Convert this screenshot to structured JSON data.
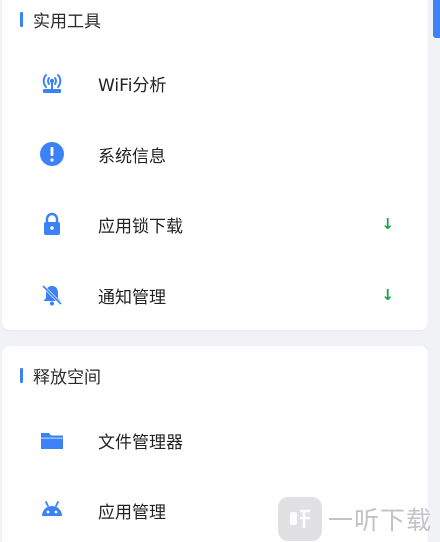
{
  "sections": [
    {
      "title": "实用工具",
      "items": [
        {
          "label": "WiFi分析",
          "icon": "wifi-router-icon",
          "badge": ""
        },
        {
          "label": "系统信息",
          "icon": "info-exclamation-icon",
          "badge": ""
        },
        {
          "label": "应用锁下载",
          "icon": "lock-icon",
          "badge": "↓"
        },
        {
          "label": "通知管理",
          "icon": "bell-off-icon",
          "badge": "↓"
        }
      ]
    },
    {
      "title": "释放空间",
      "items": [
        {
          "label": "文件管理器",
          "icon": "folder-icon",
          "badge": ""
        },
        {
          "label": "应用管理",
          "icon": "android-icon",
          "badge": ""
        }
      ]
    }
  ],
  "watermark": {
    "text": "一听下载",
    "icon": "yiting-logo-icon"
  },
  "colors": {
    "accent": "#3b82f6",
    "icon": "#3b82f6",
    "badge": "#16a34a",
    "background": "#f1f2f6"
  }
}
